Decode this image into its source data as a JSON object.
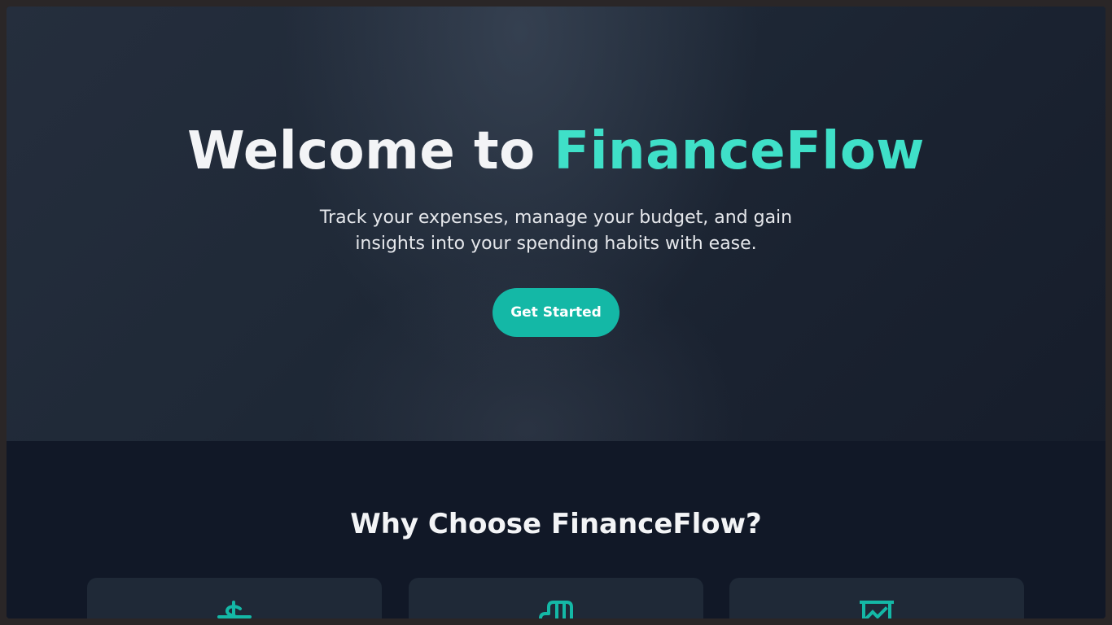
{
  "hero": {
    "title_prefix": "Welcome to ",
    "title_brand": "FinanceFlow",
    "subtitle": "Track your expenses, manage your budget, and gain insights into your spending habits with ease.",
    "cta_label": "Get Started"
  },
  "features": {
    "heading": "Why Choose FinanceFlow?",
    "cards": [
      {
        "icon": "dollar-icon"
      },
      {
        "icon": "bar-chart-icon"
      },
      {
        "icon": "trend-chart-icon"
      }
    ]
  },
  "colors": {
    "accent": "#3fe0c8",
    "button": "#14b8a6",
    "hero_bg": "#1f2937",
    "page_bg": "#111827",
    "card_bg": "#1f2937"
  }
}
